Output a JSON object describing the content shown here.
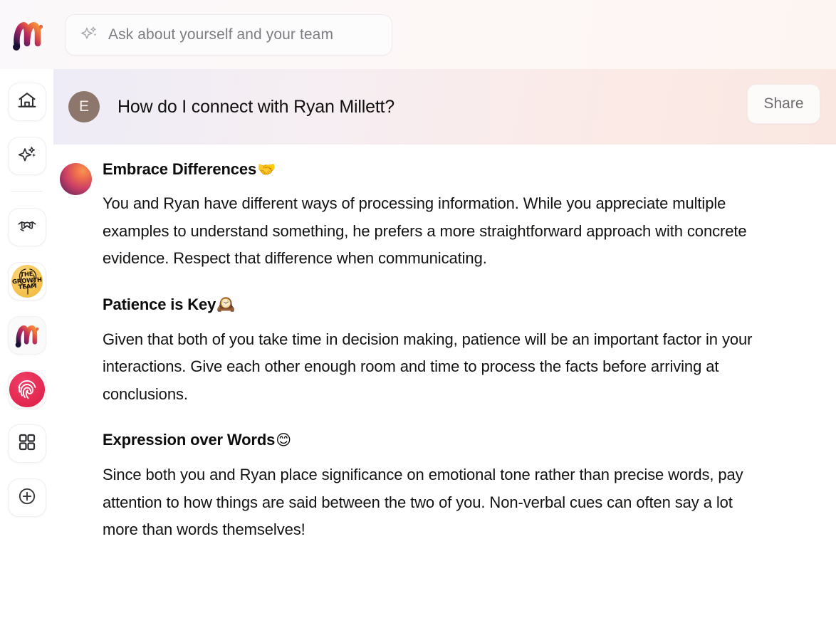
{
  "topbar": {
    "logo_icon": "mirro-m-logo",
    "search": {
      "icon": "sparkle-icon",
      "placeholder": "Ask about yourself and your team",
      "value": ""
    }
  },
  "sidebar": {
    "items": [
      {
        "id": "home",
        "icon": "home-icon",
        "label": "Home"
      },
      {
        "id": "assistant",
        "icon": "sparkle-icon",
        "label": "Assistant"
      },
      {
        "id": "connections",
        "icon": "handshake-icon",
        "label": "Connections"
      },
      {
        "id": "growth-team",
        "icon": "growth-team-badge-icon",
        "label": "The Growth Team",
        "badge_text": "THE GROWTH TEAM"
      },
      {
        "id": "workspace",
        "icon": "mirro-m-logo-icon",
        "label": "Workspace"
      },
      {
        "id": "fingerprint",
        "icon": "fingerprint-icon",
        "label": "Fingerprint"
      },
      {
        "id": "apps",
        "icon": "grid-apps-icon",
        "label": "Apps"
      },
      {
        "id": "add",
        "icon": "plus-circle-icon",
        "label": "Add"
      }
    ]
  },
  "conversation": {
    "user": {
      "avatar_initial": "E",
      "avatar_color": "#8d776c",
      "question": "How do I connect with Ryan Millett?"
    },
    "share_label": "Share",
    "assistant": {
      "avatar_icon": "gradient-sphere-avatar",
      "sections": [
        {
          "title": "Embrace Differences",
          "emoji": "handshake",
          "body": "You and Ryan have different ways of processing information. While you appreciate multiple examples to understand something, he prefers a more straightforward approach with concrete evidence. Respect that difference when communicating."
        },
        {
          "title": "Patience is Key",
          "emoji": "mantelpiece-clock",
          "body": "Given that both of you take time in decision making, patience will be an important factor in your interactions. Give each other enough room and time to process the facts before arriving at conclusions."
        },
        {
          "title": "Expression over Words",
          "emoji": "smiling-face",
          "body": "Since both you and Ryan place significance on emotional tone rather than precise words, pay attention to how things are said between the two of you. Non-verbal cues can often say a lot more than words themselves!"
        }
      ]
    }
  },
  "colors": {
    "brand_gradient_start": "#2d1b4e",
    "brand_gradient_end": "#f4873f",
    "fingerprint_red": "#e42a52",
    "growth_badge_yellow": "#f6c452",
    "avatar_taupe": "#8d776c"
  }
}
